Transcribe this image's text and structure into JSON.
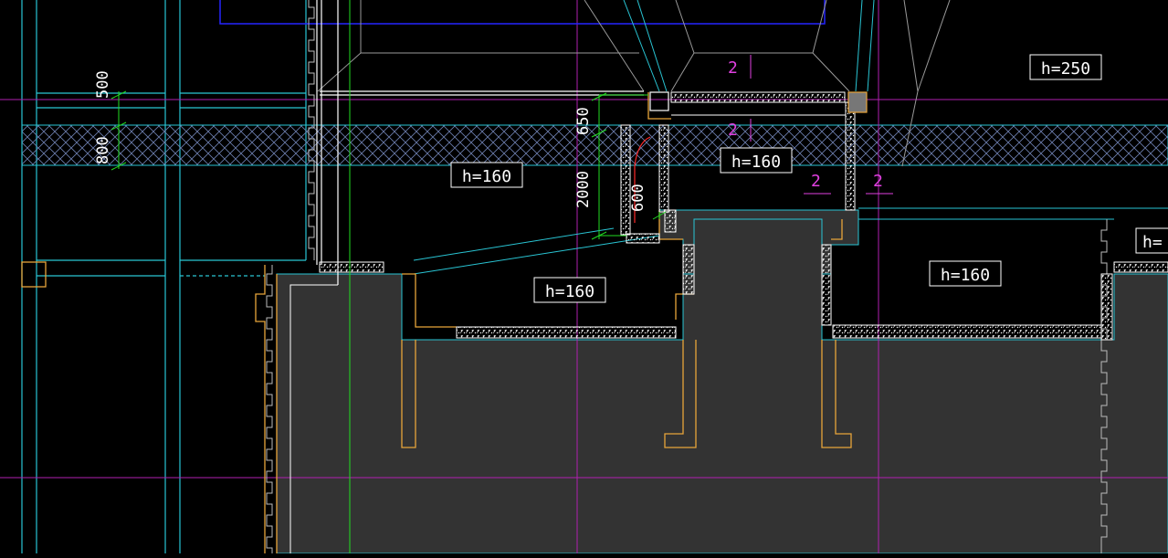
{
  "colors": {
    "background": "#000000",
    "slab_fill": "#333333",
    "cyan": "#29c5d4",
    "white": "#ffffff",
    "magenta_axis": "#b01fb0",
    "magenta_text": "#e040e0",
    "orange": "#e8a53a",
    "green": "#22dd22",
    "blue": "#2525ff",
    "grey_line": "#9a9a9a",
    "red": "#ff2a2a"
  },
  "slab_labels": [
    {
      "id": "slab-h250",
      "text": "h=250"
    },
    {
      "id": "slab-h160-upper-mid",
      "text": "h=160"
    },
    {
      "id": "slab-h160-left",
      "text": "h=160"
    },
    {
      "id": "slab-h160-center",
      "text": "h=160"
    },
    {
      "id": "slab-h160-right",
      "text": "h=160"
    },
    {
      "id": "slab-h-edge",
      "text": "h="
    }
  ],
  "dimensions": [
    {
      "id": "dim-500",
      "text": "500"
    },
    {
      "id": "dim-800",
      "text": "800"
    },
    {
      "id": "dim-650",
      "text": "650"
    },
    {
      "id": "dim-2000",
      "text": "2000"
    },
    {
      "id": "dim-600",
      "text": "600"
    }
  ],
  "section_marks": [
    {
      "id": "mark-1",
      "text": "2"
    },
    {
      "id": "mark-2",
      "text": "2"
    },
    {
      "id": "mark-3",
      "text": "2"
    },
    {
      "id": "mark-4",
      "text": "2"
    }
  ]
}
